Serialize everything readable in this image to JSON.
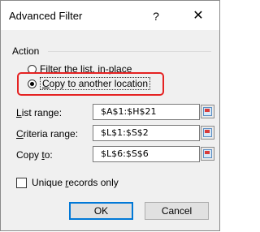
{
  "dialog": {
    "title": "Advanced Filter",
    "help_glyph": "?",
    "close_glyph": "✕"
  },
  "action": {
    "group_label": "Action",
    "options": [
      {
        "pre": "",
        "accel": "F",
        "post": "ilter the list, in-place",
        "selected": false
      },
      {
        "pre": "",
        "accel": "C",
        "post": "opy to another location",
        "selected": true
      }
    ],
    "highlight_color": "#e52222"
  },
  "fields": {
    "list_range": {
      "label_pre": "",
      "label_accel": "L",
      "label_post": "ist range:",
      "value": "$A$1:$H$21"
    },
    "criteria_range": {
      "label_pre": "",
      "label_accel": "C",
      "label_post": "riteria range:",
      "value": "$L$1:$S$2"
    },
    "copy_to": {
      "label_pre": "Copy ",
      "label_accel": "t",
      "label_post": "o:",
      "value": "$L$6:$S$6"
    }
  },
  "unique": {
    "pre": "Unique ",
    "accel": "r",
    "post": "ecords only",
    "checked": false
  },
  "buttons": {
    "ok": "OK",
    "cancel": "Cancel"
  }
}
